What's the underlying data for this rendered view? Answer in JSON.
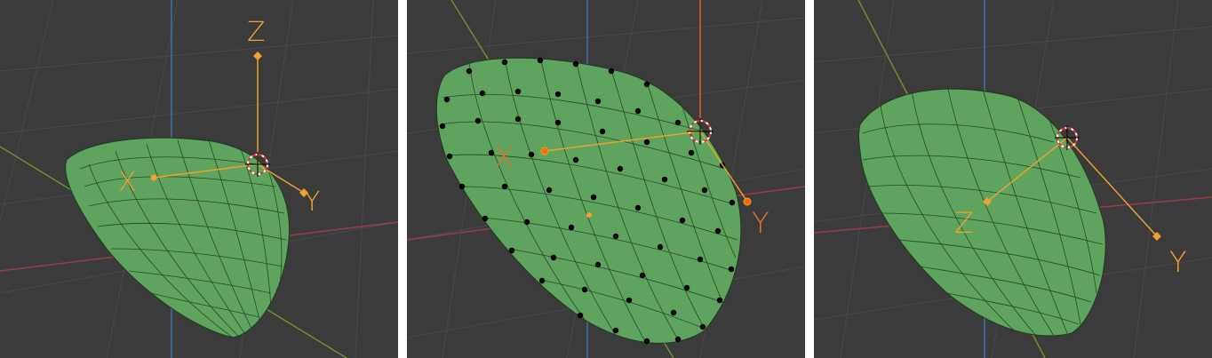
{
  "colors": {
    "viewport_bg": "#3b3b3b",
    "grid": "#4a4a4a",
    "mesh_fill": "#5ea35e",
    "mesh_wire": "#1e3a1e",
    "axis_x": "#9c3b45",
    "axis_y": "#6f8f2f",
    "axis_z": "#3f6fb0",
    "gizmo": "#f0a030",
    "vertex": "#000000",
    "selected_vertex": "#ff6a00"
  },
  "viewports": [
    {
      "name": "viewport-left",
      "gizmo_labels": {
        "z": "Z",
        "x": "X",
        "y": "Y"
      }
    },
    {
      "name": "viewport-center",
      "gizmo_labels": {
        "x": "X",
        "y": "Y"
      }
    },
    {
      "name": "viewport-right",
      "gizmo_labels": {
        "z": "Z",
        "y": "Y"
      }
    }
  ]
}
